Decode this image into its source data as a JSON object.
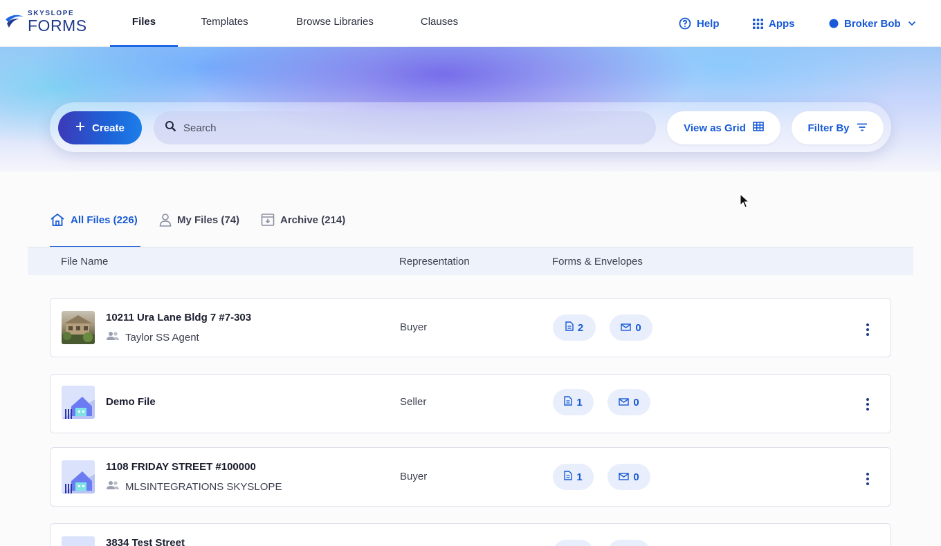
{
  "brand": {
    "top": "SKYSLOPE",
    "main": "FORMS"
  },
  "nav": {
    "tabs": [
      {
        "label": "Files",
        "active": true
      },
      {
        "label": "Templates",
        "active": false
      },
      {
        "label": "Browse Libraries",
        "active": false
      },
      {
        "label": "Clauses",
        "active": false
      }
    ],
    "help": "Help",
    "apps": "Apps",
    "user": "Broker Bob"
  },
  "toolbar": {
    "create_label": "Create",
    "search_placeholder": "Search",
    "view_grid_label": "View as Grid",
    "filter_label": "Filter By"
  },
  "file_tabs": [
    {
      "label": "All Files (226)",
      "active": true,
      "icon": "home-icon"
    },
    {
      "label": "My Files (74)",
      "active": false,
      "icon": "person-icon"
    },
    {
      "label": "Archive (214)",
      "active": false,
      "icon": "archive-icon"
    }
  ],
  "table": {
    "columns": [
      "File Name",
      "Representation",
      "Forms & Envelopes"
    ],
    "rows": [
      {
        "name": "10211 Ura Lane Bldg 7 #7-303",
        "agent": "Taylor SS Agent",
        "representation": "Buyer",
        "forms": "2",
        "envelopes": "0",
        "thumb": "house-photo"
      },
      {
        "name": "Demo File",
        "agent": "",
        "representation": "Seller",
        "forms": "1",
        "envelopes": "0",
        "thumb": "house-illustration"
      },
      {
        "name": "1108 FRIDAY STREET #100000",
        "agent": "MLSINTEGRATIONS SKYSLOPE",
        "representation": "Buyer",
        "forms": "1",
        "envelopes": "0",
        "thumb": "house-illustration"
      },
      {
        "name": "3834 Test Street",
        "agent": "",
        "representation": "",
        "forms": "",
        "envelopes": "",
        "thumb": "house-illustration"
      }
    ]
  },
  "colors": {
    "accent": "#1759d6",
    "brand": "#1f3a8a",
    "chip_bg": "#e8eefb"
  }
}
